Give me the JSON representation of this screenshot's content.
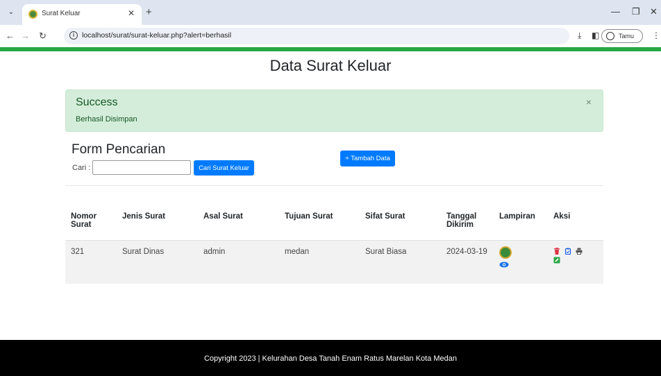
{
  "browser": {
    "tab_title": "Surat Keluar",
    "url": "localhost/surat/surat-keluar.php?alert=berhasil",
    "profile_label": "Tamu"
  },
  "page": {
    "title": "Data Surat Keluar"
  },
  "alert": {
    "heading": "Success",
    "message": "Berhasil Disimpan",
    "close": "×"
  },
  "search": {
    "title": "Form Pencarian",
    "label": "Cari :",
    "value": "",
    "placeholder": "",
    "button": "Cari Surat Keluar"
  },
  "add_button": "+ Tambah Data",
  "table": {
    "headers": [
      "Nomor Surat",
      "Jenis Surat",
      "Asal Surat",
      "Tujuan Surat",
      "Sifat Surat",
      "Tanggal Dikirim",
      "Lampiran",
      "Aksi"
    ],
    "rows": [
      {
        "nomor": "321",
        "jenis": "Surat Dinas",
        "asal": "admin",
        "tujuan": "medan",
        "sifat": "Surat Biasa",
        "tanggal": "2024-03-19"
      }
    ]
  },
  "footer": "Copyright 2023 | Kelurahan Desa Tanah Enam Ratus Marelan Kota Medan",
  "colors": {
    "primary": "#007bff",
    "success_bg": "#d4edda",
    "success_text": "#155724",
    "accent_green": "#28a745",
    "delete_red": "#dc3545"
  },
  "icons": [
    "tab-menu-icon",
    "info-icon",
    "download-icon",
    "sidepanel-icon",
    "profile-icon",
    "eye-icon",
    "trash-icon",
    "clipboard-icon",
    "print-icon",
    "edit-icon"
  ]
}
